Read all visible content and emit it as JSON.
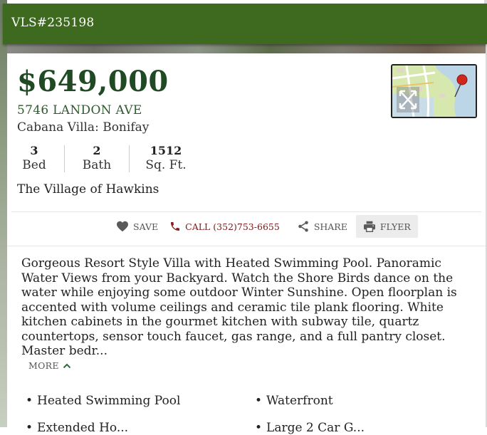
{
  "header": {
    "mls_number": "VLS#235198"
  },
  "listing": {
    "price": "$649,000",
    "address": "5746 LANDON AVE",
    "model": "Cabana Villa: Bonifay",
    "stats": [
      {
        "value": "3",
        "label": "Bed"
      },
      {
        "value": "2",
        "label": "Bath"
      },
      {
        "value": "1512",
        "label": "Sq. Ft."
      }
    ],
    "subdivision": "The Village of Hawkins"
  },
  "actions": {
    "save_label": "SAVE",
    "call_label": "CALL (352)753-6655",
    "share_label": "SHARE",
    "flyer_label": "FLYER"
  },
  "description": {
    "text": "Gorgeous Resort Style Villa with Heated Swimming Pool. Panoramic Water Views from your Backyard. Watch the Shore Birds dance on the water while enjoying some outdoor Winter Sunshine. Open floorplan is accented with volume ceilings and ceramic tile plank flooring. White kitchen cabinets in the gourmet kitchen with subway tile, quartz countertops, sensor touch faucet, gas range, and a full pantry closet. Master bedr...",
    "more_label": "MORE"
  },
  "features": [
    "Heated Swimming Pool",
    "Waterfront",
    "Extended Ho...",
    "Large 2 Car G..."
  ],
  "colors": {
    "header_green": "#3e6a1f",
    "price_green": "#1f4a24",
    "call_red": "#7a1a1a",
    "map_pin_red": "#d0261c"
  },
  "icons": {
    "save": "heart-icon",
    "call": "phone-icon",
    "share": "share-icon",
    "flyer": "printer-icon",
    "more": "chevron-up-icon",
    "map": "expand-arrows-icon"
  }
}
